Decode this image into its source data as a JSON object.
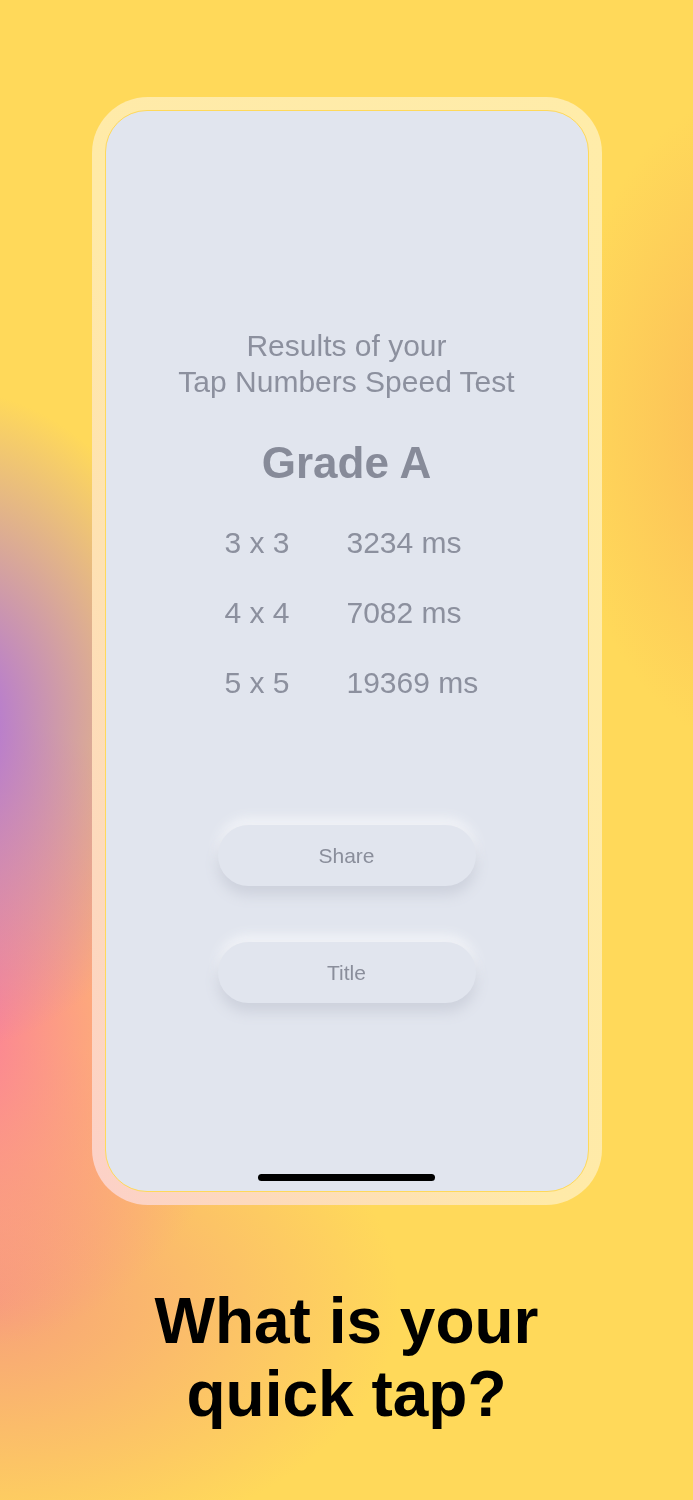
{
  "phone": {
    "screen": {
      "heading_lines": [
        "Results of your",
        "Tap Numbers Speed Test"
      ],
      "grade": "Grade A",
      "results": [
        {
          "grid": "3 x 3",
          "time": "3234 ms"
        },
        {
          "grid": "4 x 4",
          "time": "7082 ms"
        },
        {
          "grid": "5 x 5",
          "time": "19369 ms"
        }
      ],
      "buttons": [
        "Share",
        "Title"
      ]
    }
  },
  "caption_lines": [
    "What is your",
    "quick tap?"
  ]
}
